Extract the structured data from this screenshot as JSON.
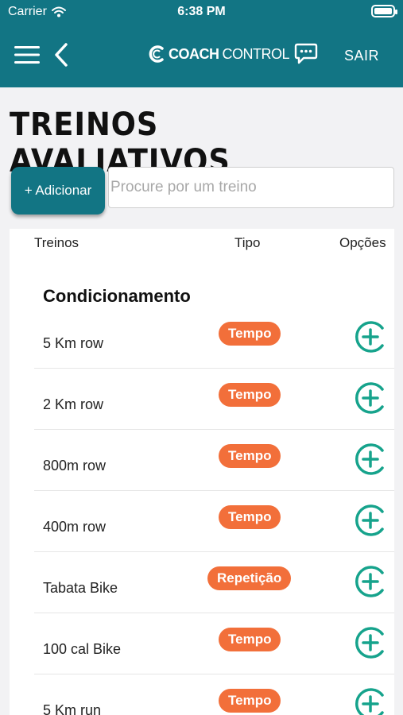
{
  "status_bar": {
    "carrier": "Carrier",
    "time": "6:38 PM"
  },
  "header": {
    "brand_strong": "COACH",
    "brand_light": "CONTROL",
    "logout_label": "SAIR"
  },
  "page": {
    "title": "TREINOS AVALIATIVOS"
  },
  "actions": {
    "add_label": "+ Adicionar",
    "search_placeholder": "Procure por um treino"
  },
  "table": {
    "headers": {
      "name": "Treinos",
      "type": "Tipo",
      "options": "Opções"
    },
    "section": "Condicionamento",
    "rows": [
      {
        "name": "5 Km row",
        "type": "Tempo"
      },
      {
        "name": "2 Km row",
        "type": "Tempo"
      },
      {
        "name": "800m row",
        "type": "Tempo"
      },
      {
        "name": "400m row",
        "type": "Tempo"
      },
      {
        "name": "Tabata Bike",
        "type": "Repetição"
      },
      {
        "name": "100 cal Bike",
        "type": "Tempo"
      },
      {
        "name": "5 Km run",
        "type": "Tempo"
      }
    ]
  },
  "icons": {
    "menu": "hamburger-icon",
    "back": "chevron-left-icon",
    "chat": "chat-bubble-icon",
    "add": "plus-circle-icon"
  },
  "colors": {
    "primary": "#127584",
    "badge": "#f26f3a",
    "accent_icon": "#16a38c",
    "background": "#f2f2f4"
  }
}
